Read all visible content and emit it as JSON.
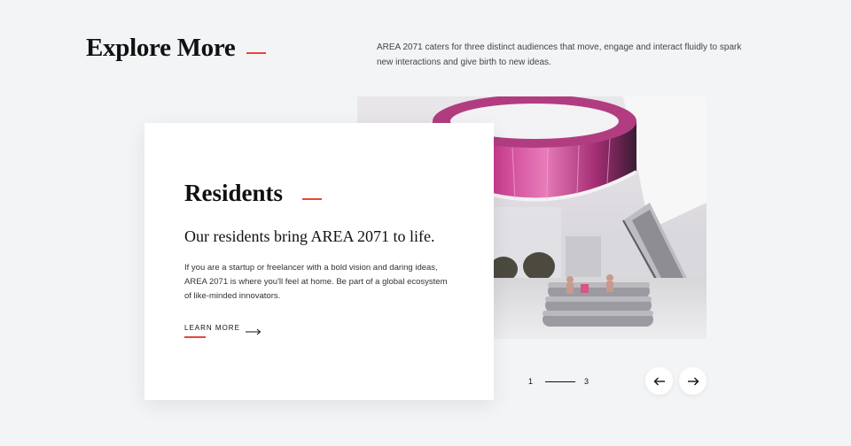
{
  "section": {
    "title": "Explore More",
    "intro": "AREA 2071 caters for three distinct audiences that move, engage and interact fluidly to spark new interactions and give birth to new ideas."
  },
  "card": {
    "title": "Residents",
    "subtitle": "Our residents bring AREA 2071 to life.",
    "body": "If you are a startup or freelancer with a bold vision and daring ideas, AREA 2071 is where you'll feel at home. Be part of a global ecosystem of like-minded innovators.",
    "cta_label": "LEARN MORE"
  },
  "hero_image": {
    "alt_subject": "atrium with ring-shaped LED installation, escalator and lounge seating"
  },
  "pager": {
    "current": "1",
    "total": "3"
  },
  "icons": {
    "prev": "arrow-left-icon",
    "next": "arrow-right-icon",
    "cta": "arrow-right-icon"
  },
  "colors": {
    "accent": "#e8473a",
    "background": "#f3f4f6",
    "card": "#ffffff",
    "text": "#111111"
  }
}
